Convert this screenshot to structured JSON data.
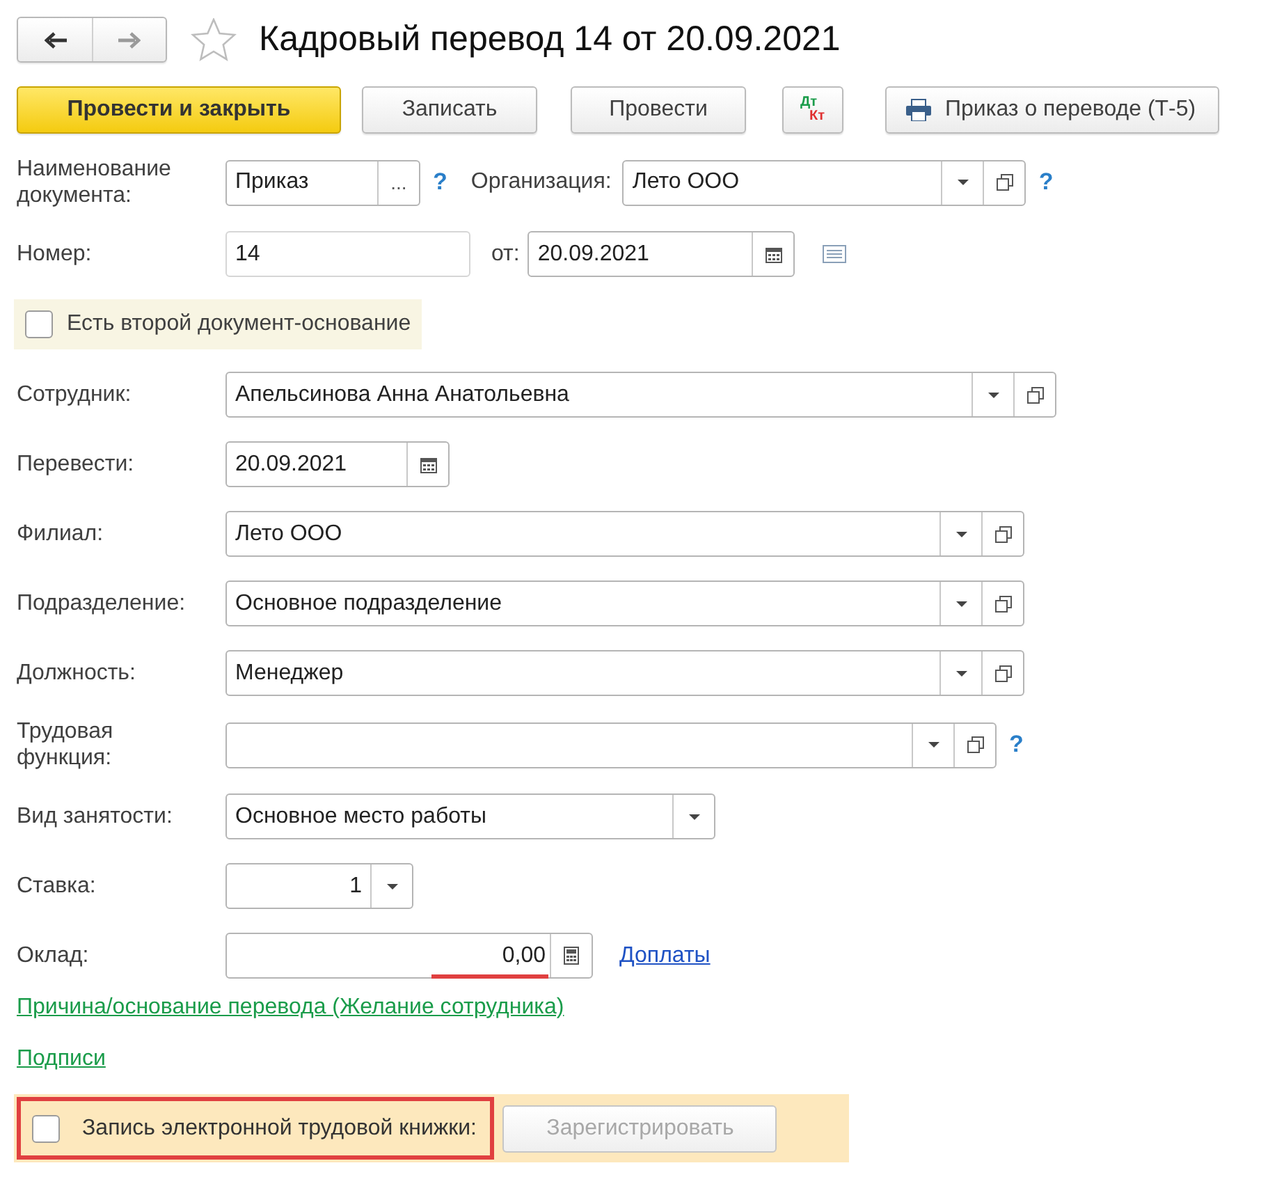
{
  "header": {
    "title": "Кадровый перевод 14 от 20.09.2021",
    "favorite": false
  },
  "toolbar": [
    {
      "kind": "primary",
      "label": "Провести и закрыть"
    },
    {
      "kind": "normal",
      "label": "Записать"
    },
    {
      "kind": "normal",
      "label": "Провести"
    },
    {
      "kind": "dt-kt",
      "top": "Дт",
      "bottom": "Кт"
    },
    {
      "kind": "print",
      "label": "Приказ о переводе (Т-5)"
    }
  ],
  "form": [
    {
      "kind": "doc-name",
      "label": "Наименование документа:",
      "value": "Приказ",
      "select_button": "...",
      "help": "?",
      "org_label": "Организация:",
      "org_value": "Лето ООО",
      "org_help": "?"
    },
    {
      "kind": "number",
      "label": "Номер:",
      "value": "14",
      "date_label": "от:",
      "date": "20.09.2021"
    },
    {
      "kind": "checkbox",
      "label": "Есть второй документ-основание",
      "checked": false
    },
    {
      "kind": "select",
      "label": "Сотрудник:",
      "value": "Апельсинова Анна Анатольевна",
      "open_button": true
    },
    {
      "kind": "date",
      "label": "Перевести:",
      "value": "20.09.2021"
    },
    {
      "kind": "select",
      "label": "Филиал:",
      "value": "Лето ООО",
      "open_button": true
    },
    {
      "kind": "select",
      "label": "Подразделение:",
      "value": "Основное подразделение",
      "open_button": true
    },
    {
      "kind": "select",
      "label": "Должность:",
      "value": "Менеджер",
      "open_button": true
    },
    {
      "kind": "select",
      "label": "Трудовая функция:",
      "open_button": true,
      "help": "?"
    },
    {
      "kind": "select",
      "label": "Вид занятости:",
      "value": "Основное место работы",
      "open_button": false
    },
    {
      "kind": "number-select",
      "label": "Ставка:",
      "value": "1"
    },
    {
      "kind": "money",
      "label": "Оклад:",
      "value": "0,00",
      "unfilled": true,
      "link": "Доплаты"
    }
  ],
  "links": [
    "Причина/основание перевода (Желание сотрудника)",
    "Подписи"
  ],
  "footer": {
    "checkbox_label": "Запись электронной трудовой книжки:",
    "checked": false,
    "highlighted": true,
    "button": "Зарегистрировать",
    "button_disabled": true
  }
}
